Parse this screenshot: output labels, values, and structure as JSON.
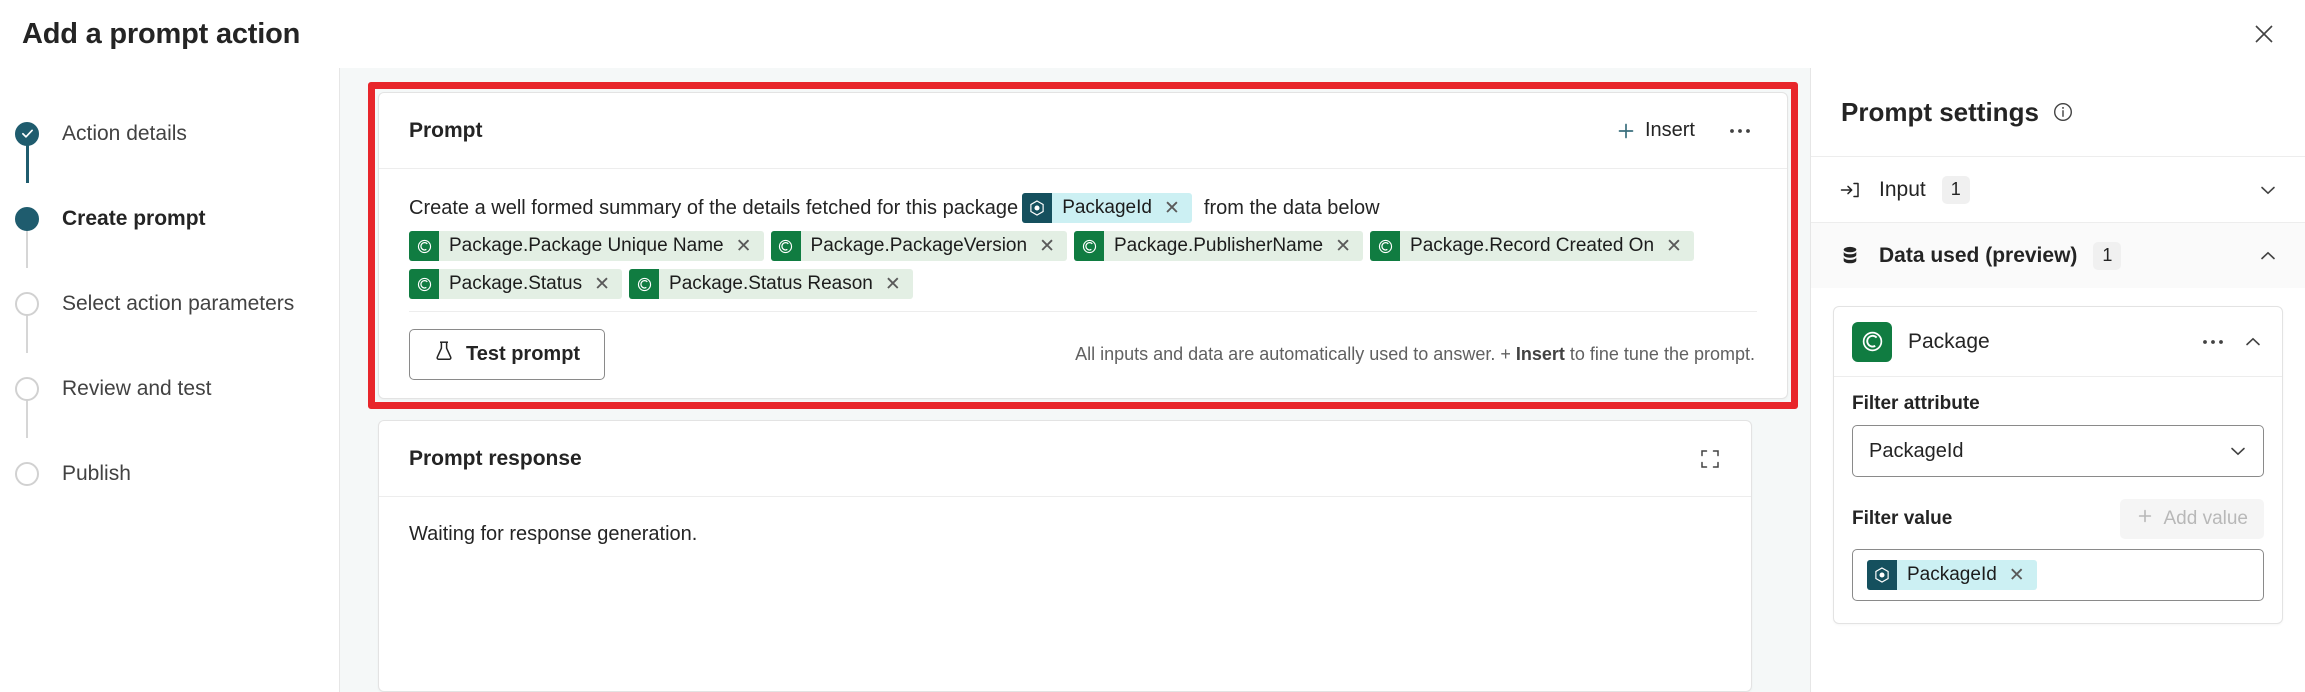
{
  "window": {
    "title": "Add a prompt action",
    "close_icon": "close-icon"
  },
  "stepper": {
    "steps": [
      {
        "label": "Action details",
        "state": "done"
      },
      {
        "label": "Create prompt",
        "state": "current"
      },
      {
        "label": "Select action parameters",
        "state": "pending"
      },
      {
        "label": "Review and test",
        "state": "pending"
      },
      {
        "label": "Publish",
        "state": "pending"
      }
    ]
  },
  "prompt_card": {
    "title": "Prompt",
    "insert_label": "Insert",
    "insert_icon": "plus-icon",
    "more_icon": "more-horizontal-icon",
    "text_before": "Create a well formed summary of the details fetched for this package",
    "text_after": "from the data below",
    "inline_token": {
      "label": "PackageId",
      "type": "blue",
      "icon": "package-id-icon"
    },
    "data_tokens": [
      {
        "label": "Package.Package Unique Name",
        "type": "green",
        "icon": "dataverse-table-icon"
      },
      {
        "label": "Package.PackageVersion",
        "type": "green",
        "icon": "dataverse-table-icon"
      },
      {
        "label": "Package.PublisherName",
        "type": "green",
        "icon": "dataverse-table-icon"
      },
      {
        "label": "Package.Record Created On",
        "type": "green",
        "icon": "dataverse-table-icon"
      },
      {
        "label": "Package.Status",
        "type": "green",
        "icon": "dataverse-table-icon"
      },
      {
        "label": "Package.Status Reason",
        "type": "green",
        "icon": "dataverse-table-icon"
      }
    ],
    "token_rows": [
      4,
      2
    ],
    "test_button": {
      "label": "Test prompt",
      "icon": "flask-icon"
    },
    "footer_note_1": "All inputs and data are automatically used to answer. + ",
    "footer_note_bold": "Insert",
    "footer_note_2": " to fine tune the prompt."
  },
  "response_card": {
    "title": "Prompt response",
    "expand_icon": "expand-icon",
    "body_text": "Waiting for response generation."
  },
  "settings": {
    "title": "Prompt settings",
    "info_icon": "info-icon",
    "sections": [
      {
        "label": "Input",
        "badge": "1",
        "icon": "input-arrow-icon",
        "expanded": false
      },
      {
        "label": "Data used (preview)",
        "badge": "1",
        "icon": "database-icon",
        "expanded": true
      }
    ],
    "package": {
      "name": "Package",
      "icon": "dataverse-table-icon",
      "more_icon": "more-horizontal-icon",
      "collapse_icon": "chevron-up-icon",
      "filter_attribute_label": "Filter attribute",
      "filter_attribute_value": "PackageId",
      "filter_value_label": "Filter value",
      "add_value_label": "Add value",
      "add_value_icon": "plus-icon",
      "filter_value_token": {
        "label": "PackageId",
        "type": "blue",
        "icon": "package-id-icon"
      }
    }
  },
  "colors": {
    "accent_teal": "#1f5c6e",
    "highlight_red": "#e8262b",
    "token_green": "#107c41",
    "token_blue": "#15505e",
    "canvas_bg": "#f5f8f8"
  }
}
